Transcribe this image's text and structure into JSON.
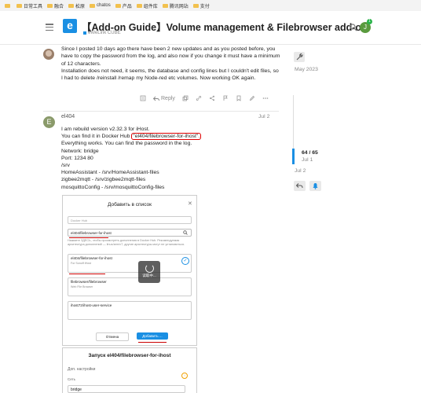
{
  "bookmarks": [
    {
      "label": ""
    },
    {
      "label": "日常工具"
    },
    {
      "label": "融合"
    },
    {
      "label": "松原"
    },
    {
      "label": "chatos"
    },
    {
      "label": "产品"
    },
    {
      "label": "组件库"
    },
    {
      "label": "腾讯网站"
    },
    {
      "label": "支付"
    }
  ],
  "header": {
    "logo_letter": "e",
    "title": "【Add-on Guide】Volume management & Filebrowser add-on",
    "category": "eWeLink CUBE",
    "avatar_letter": "J",
    "notification_count": "1"
  },
  "post1": {
    "paragraph1": "Since I posted 10 days ago there have been 2 new updates and as you posted before, you have to copy the password from the log, and also now if you change it must have a minimum of 12 characters.",
    "paragraph2": "Installation does not need, it seems, the database and config lines but I couldn't edit files, so I had to delete /reinstall /remap my Node-red etc volumes. Now working OK again.",
    "reply_label": "Reply"
  },
  "post2": {
    "avatar_letter": "E",
    "username": "el404",
    "date": "Jul 2",
    "line1": "I am rebuild version v2.32.3 for iHost.",
    "line2_prefix": "You can find it in Docker Hub ",
    "line2_highlight": "\"el404/filebrowser-for-ihost\".",
    "line3": "Everything works. You can find the password in the log.",
    "line4": "Network: bridge",
    "line5": "Port: 1234 80",
    "line6": "/srv",
    "line7": "HomeAssistant - /srv/HomeAssistant-files",
    "line8": "zigbee2mqtt - /srv/zigbee2mqtt-files",
    "line9": "mosquittoConfig - /srv/mosquittoConfig-files"
  },
  "screenshot1": {
    "title": "Добавить в список",
    "registry": "Docker Hub",
    "search_value": "el404/filebrowser-for-ihost",
    "note": "Нажмите ЗДЕСЬ, чтобы просмотреть дополнения в Docker Hub. Рекомендуемая архитектура дополнений — linux/arm/v7, другие архитектуры могут не установиться.",
    "items": [
      {
        "title": "el404/filebrowser-for-ihost",
        "sub": "For Sonoff iHost"
      },
      {
        "title": "filebrowser/filebrowser",
        "sub": "Web File Browser"
      },
      {
        "title": "ihost72/ihost-user-service",
        "sub": ""
      }
    ],
    "loading_text": "读取中...",
    "cancel_label": "Отмена",
    "add_label": "Добавить ..."
  },
  "screenshot2": {
    "title": "Запуск el404/filebrowser-for-ihost",
    "section": "Доп. настройки",
    "network_label": "Сеть",
    "network_value": "bridge"
  },
  "timeline": {
    "top_date": "May 2023",
    "position": "64 / 65",
    "position_date": "Jul 1",
    "bottom_date": "Jul 2"
  }
}
